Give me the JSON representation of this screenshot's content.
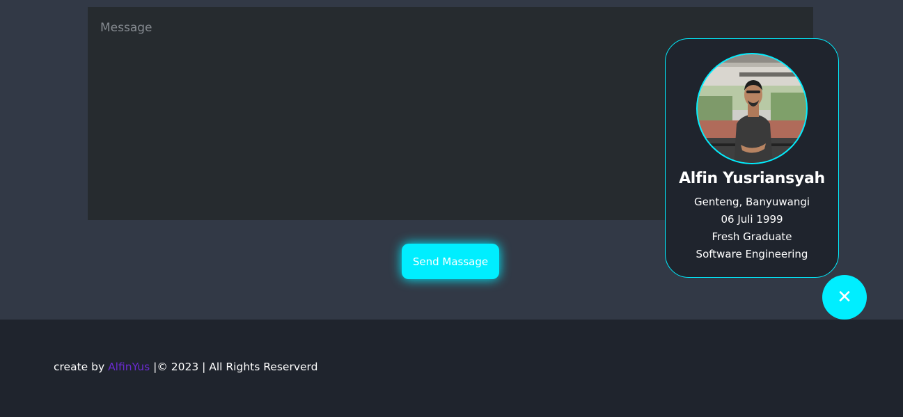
{
  "contact": {
    "message_placeholder": "Message",
    "send_label": "Send Massage"
  },
  "profile": {
    "name": "Alfin Yusriansyah",
    "location": "Genteng, Banyuwangi",
    "birth_date": "06 Juli 1999",
    "status": "Fresh Graduate",
    "field": "Software Engineering",
    "close_icon": "close-icon"
  },
  "footer": {
    "prefix": "create by ",
    "author": "AlfinYus",
    "suffix": " |© 2023 | All Rights Reserverd"
  },
  "colors": {
    "accent": "#00eeff",
    "background": "#323946",
    "footer_bg": "#1f242d",
    "link": "#6a2bd0"
  }
}
